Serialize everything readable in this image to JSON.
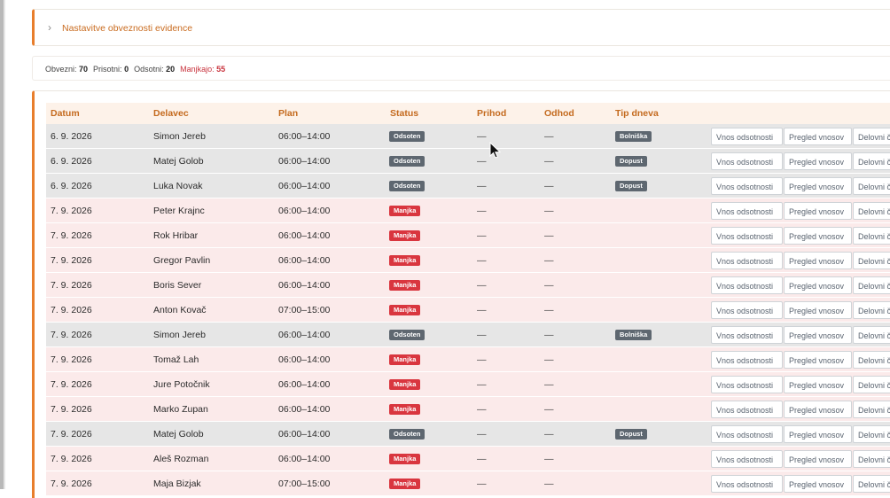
{
  "settings": {
    "title": "Nastavitve obveznosti evidence"
  },
  "summary": [
    {
      "label": "Obvezni:",
      "value": "70",
      "missing": false
    },
    {
      "label": "Prisotni:",
      "value": "0",
      "missing": false
    },
    {
      "label": "Odsotni:",
      "value": "20",
      "missing": false
    },
    {
      "label": "Manjkajo:",
      "value": "55",
      "missing": true
    }
  ],
  "columns": [
    "Datum",
    "Delavec",
    "Plan",
    "Status",
    "Prihod",
    "Odhod",
    "Tip dneva"
  ],
  "actions": [
    "Vnos odsotnosti",
    "Pregled vnosov",
    "Delovni čas"
  ],
  "rows": [
    {
      "date": "6. 9. 2026",
      "worker": "Simon Jereb",
      "plan": "06:00–14:00",
      "status": "Odsoten",
      "kind": "absent",
      "arrival": "—",
      "departure": "—",
      "day_type": "Bolniška"
    },
    {
      "date": "6. 9. 2026",
      "worker": "Matej Golob",
      "plan": "06:00–14:00",
      "status": "Odsoten",
      "kind": "absent",
      "arrival": "—",
      "departure": "—",
      "day_type": "Dopust"
    },
    {
      "date": "6. 9. 2026",
      "worker": "Luka Novak",
      "plan": "06:00–14:00",
      "status": "Odsoten",
      "kind": "absent",
      "arrival": "—",
      "departure": "—",
      "day_type": "Dopust"
    },
    {
      "date": "7. 9. 2026",
      "worker": "Peter Krajnc",
      "plan": "06:00–14:00",
      "status": "Manjka",
      "kind": "missing",
      "arrival": "—",
      "departure": "—",
      "day_type": ""
    },
    {
      "date": "7. 9. 2026",
      "worker": "Rok Hribar",
      "plan": "06:00–14:00",
      "status": "Manjka",
      "kind": "missing",
      "arrival": "—",
      "departure": "—",
      "day_type": ""
    },
    {
      "date": "7. 9. 2026",
      "worker": "Gregor Pavlin",
      "plan": "06:00–14:00",
      "status": "Manjka",
      "kind": "missing",
      "arrival": "—",
      "departure": "—",
      "day_type": ""
    },
    {
      "date": "7. 9. 2026",
      "worker": "Boris Sever",
      "plan": "06:00–14:00",
      "status": "Manjka",
      "kind": "missing",
      "arrival": "—",
      "departure": "—",
      "day_type": ""
    },
    {
      "date": "7. 9. 2026",
      "worker": "Anton Kovač",
      "plan": "07:00–15:00",
      "status": "Manjka",
      "kind": "missing",
      "arrival": "—",
      "departure": "—",
      "day_type": ""
    },
    {
      "date": "7. 9. 2026",
      "worker": "Simon Jereb",
      "plan": "06:00–14:00",
      "status": "Odsoten",
      "kind": "absent",
      "arrival": "—",
      "departure": "—",
      "day_type": "Bolniška"
    },
    {
      "date": "7. 9. 2026",
      "worker": "Tomaž Lah",
      "plan": "06:00–14:00",
      "status": "Manjka",
      "kind": "missing",
      "arrival": "—",
      "departure": "—",
      "day_type": ""
    },
    {
      "date": "7. 9. 2026",
      "worker": "Jure Potočnik",
      "plan": "06:00–14:00",
      "status": "Manjka",
      "kind": "missing",
      "arrival": "—",
      "departure": "—",
      "day_type": ""
    },
    {
      "date": "7. 9. 2026",
      "worker": "Marko Zupan",
      "plan": "06:00–14:00",
      "status": "Manjka",
      "kind": "missing",
      "arrival": "—",
      "departure": "—",
      "day_type": ""
    },
    {
      "date": "7. 9. 2026",
      "worker": "Matej Golob",
      "plan": "06:00–14:00",
      "status": "Odsoten",
      "kind": "absent",
      "arrival": "—",
      "departure": "—",
      "day_type": "Dopust"
    },
    {
      "date": "7. 9. 2026",
      "worker": "Aleš Rozman",
      "plan": "06:00–14:00",
      "status": "Manjka",
      "kind": "missing",
      "arrival": "—",
      "departure": "—",
      "day_type": ""
    },
    {
      "date": "7. 9. 2026",
      "worker": "Maja Bizjak",
      "plan": "07:00–15:00",
      "status": "Manjka",
      "kind": "missing",
      "arrival": "—",
      "departure": "—",
      "day_type": ""
    }
  ],
  "colors": {
    "accent": "#e87e2c",
    "absent_badge": "#5e6770",
    "missing_badge": "#d9363f",
    "absent_row": "#e6e6e6",
    "missing_row": "#fbeaea"
  }
}
